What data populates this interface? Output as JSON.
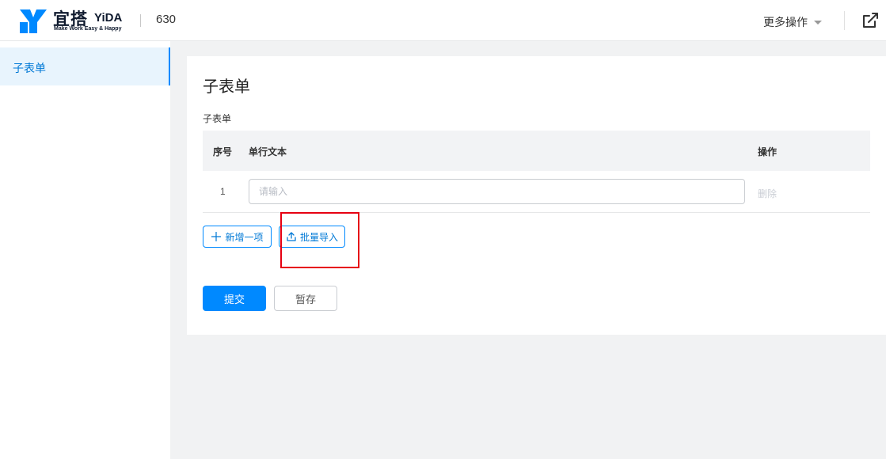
{
  "brand": {
    "name_cn": "宜搭",
    "name_en": "YiDA",
    "slogan": "Make Work Easy & Happy",
    "logo_icon": "yida-logo-icon",
    "color": "#0089ff"
  },
  "header": {
    "app_title": "630",
    "more_actions_label": "更多操作",
    "external_icon": "external-link-icon"
  },
  "sidebar": {
    "items": [
      {
        "label": "子表单",
        "active": true
      }
    ]
  },
  "form": {
    "title": "子表单",
    "subform_label": "子表单",
    "table": {
      "columns": [
        "序号",
        "单行文本",
        "操作"
      ],
      "rows": [
        {
          "index": "1",
          "value": "",
          "placeholder": "请输入",
          "action": "删除"
        }
      ]
    },
    "add_item_label": "新增一项",
    "batch_import_label": "批量导入",
    "submit_label": "提交",
    "draft_label": "暂存"
  },
  "colors": {
    "primary": "#0089ff",
    "highlight": "#e60012",
    "background": "#f1f2f3"
  }
}
